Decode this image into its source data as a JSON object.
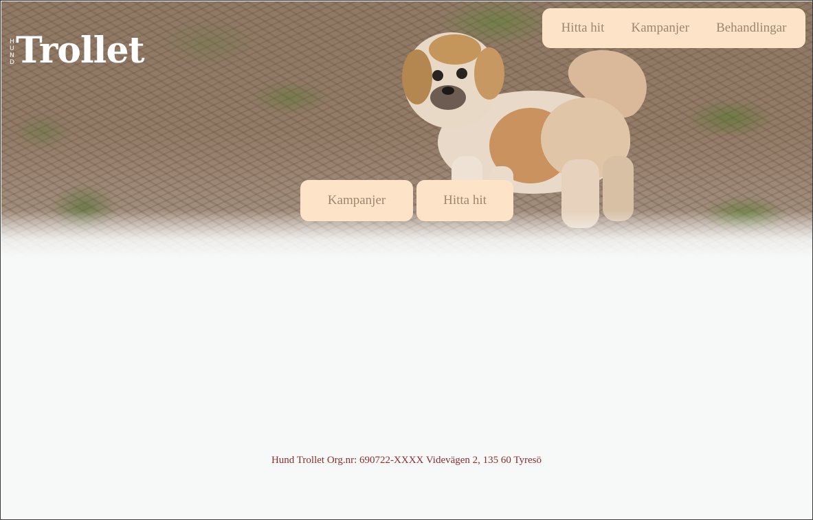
{
  "logo": {
    "small_letters": [
      "H",
      "U",
      "N",
      "D"
    ],
    "wordmark": "Trollet"
  },
  "nav": {
    "items": [
      {
        "label": "Hitta hit"
      },
      {
        "label": "Kampanjer"
      },
      {
        "label": "Behandlingar"
      }
    ]
  },
  "hero": {
    "image_subject": "small fluffy dog standing on forest floor",
    "buttons": [
      {
        "label": "Kampanjer"
      },
      {
        "label": "Hitta hit"
      }
    ]
  },
  "footer": {
    "text": "Hund Trollet Org.nr: 690722-XXXX Videvägen 2, 135 60 Tyresö"
  },
  "colors": {
    "nav_bg": "#fde3c8",
    "nav_text": "#9d8670",
    "footer_text": "#8b2c2c",
    "page_bg": "#f7f9f9"
  }
}
